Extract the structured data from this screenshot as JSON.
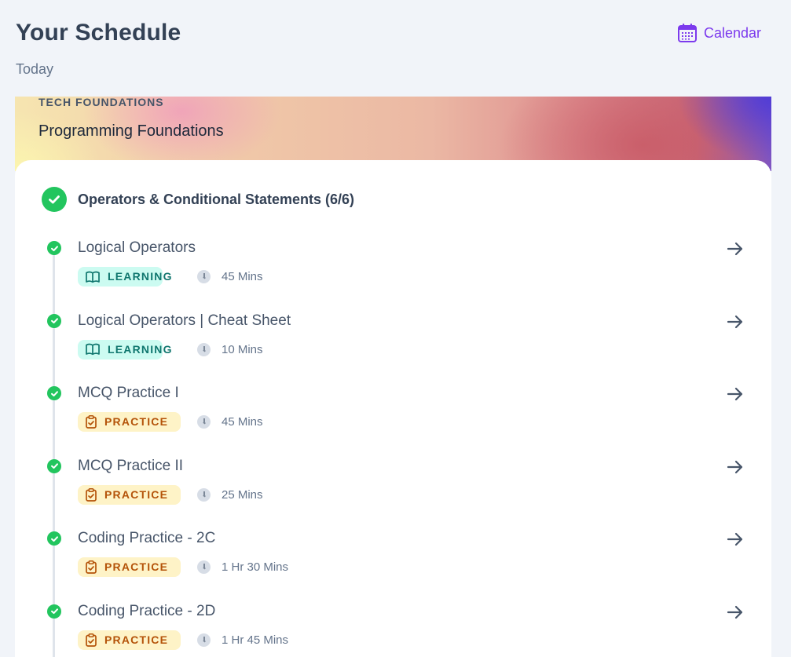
{
  "header": {
    "title": "Your Schedule",
    "calendar_label": "Calendar",
    "date_label": "Today"
  },
  "course": {
    "track": "TECH FOUNDATIONS",
    "name": "Programming Foundations"
  },
  "module": {
    "title": "Operators & Conditional Statements (6/6)",
    "completed": true
  },
  "items": [
    {
      "title": "Logical Operators",
      "type": "LEARNING",
      "duration": "45 Mins",
      "completed": true
    },
    {
      "title": "Logical Operators | Cheat Sheet",
      "type": "LEARNING",
      "duration": "10 Mins",
      "completed": true
    },
    {
      "title": "MCQ Practice I",
      "type": "PRACTICE",
      "duration": "45 Mins",
      "completed": true
    },
    {
      "title": "MCQ Practice II",
      "type": "PRACTICE",
      "duration": "25 Mins",
      "completed": true
    },
    {
      "title": "Coding Practice - 2C",
      "type": "PRACTICE",
      "duration": "1 Hr 30 Mins",
      "completed": true
    },
    {
      "title": "Coding Practice - 2D",
      "type": "PRACTICE",
      "duration": "1 Hr 45 Mins",
      "completed": true
    }
  ],
  "icons": {
    "calendar": "calendar-icon",
    "check": "check-circle-icon",
    "arrow": "arrow-right-icon",
    "learning": "book-open-icon",
    "practice": "clipboard-check-icon",
    "duration": "clock-icon"
  },
  "colors": {
    "accent": "#7c3aed",
    "success": "#22c55e",
    "learning_bg": "#ccfbf1",
    "learning_text": "#0f766e",
    "practice_bg": "#fef3c7",
    "practice_text": "#b45309"
  }
}
